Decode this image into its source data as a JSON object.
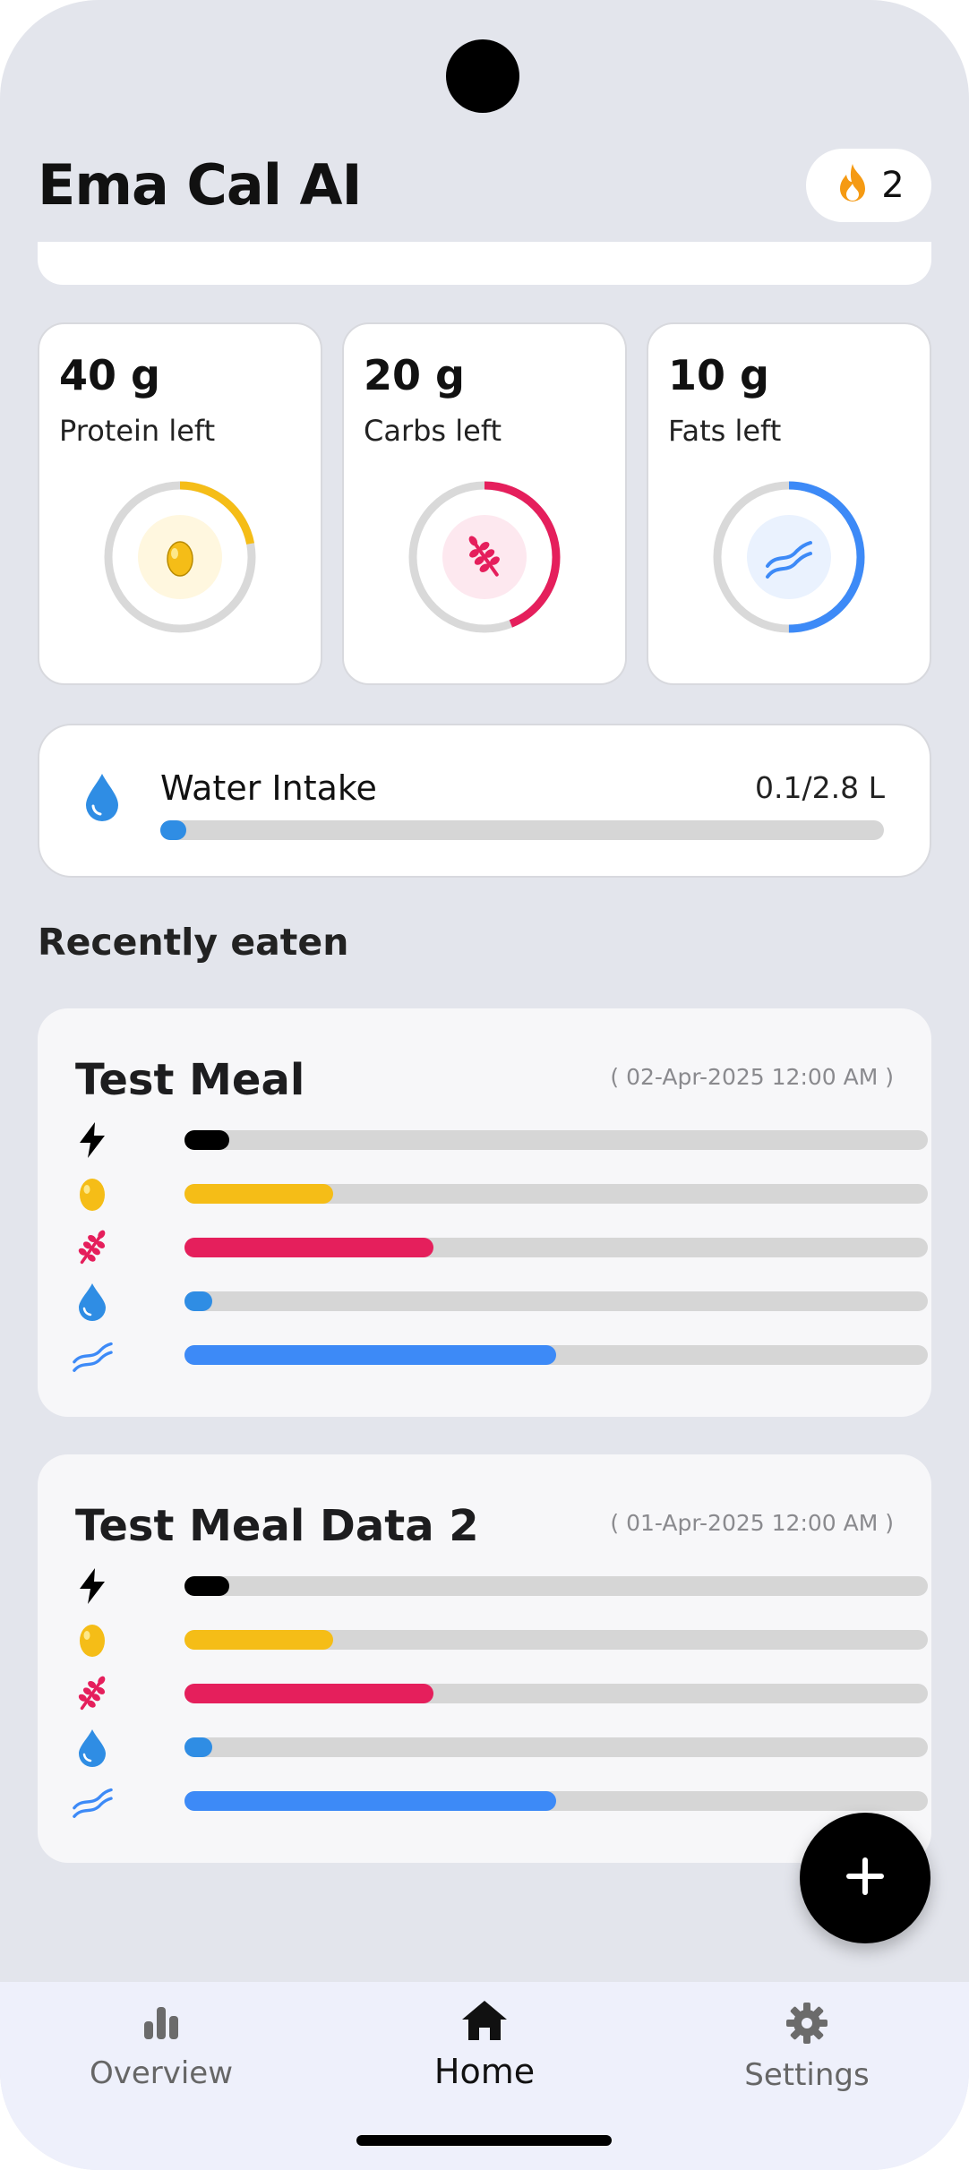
{
  "app": {
    "title": "Ema Cal AI",
    "streak_count": "2"
  },
  "macros": [
    {
      "id": "protein",
      "value": "40 g",
      "label": "Protein left",
      "progress": 0.22,
      "color": "#f5bd17",
      "bg": "#fff7df",
      "icon": "egg-icon"
    },
    {
      "id": "carbs",
      "value": "20 g",
      "label": "Carbs left",
      "progress": 0.44,
      "color": "#e51f5c",
      "bg": "#fde8ef",
      "icon": "wheat-icon"
    },
    {
      "id": "fats",
      "value": "10 g",
      "label": "Fats left",
      "progress": 0.5,
      "color": "#3d8af7",
      "bg": "#eaf2fe",
      "icon": "bacon-icon"
    }
  ],
  "water": {
    "title": "Water Intake",
    "value": "0.1/2.8 L",
    "progress": 0.036
  },
  "recent": {
    "title": "Recently eaten",
    "meals": [
      {
        "name": "Test Meal",
        "date": "( 02-Apr-2025 12:00 AM )",
        "bars": [
          {
            "icon": "lightning-icon",
            "color": "#000000",
            "progress": 0.06
          },
          {
            "icon": "egg-icon",
            "color": "#f5bd17",
            "progress": 0.2
          },
          {
            "icon": "wheat-icon",
            "color": "#e51f5c",
            "progress": 0.335
          },
          {
            "icon": "water-drop-icon",
            "color": "#2f8de4",
            "progress": 0.037
          },
          {
            "icon": "bacon-icon",
            "color": "#3d8af7",
            "progress": 0.5
          }
        ]
      },
      {
        "name": "Test Meal Data 2",
        "date": "( 01-Apr-2025 12:00 AM )",
        "bars": [
          {
            "icon": "lightning-icon",
            "color": "#000000",
            "progress": 0.06
          },
          {
            "icon": "egg-icon",
            "color": "#f5bd17",
            "progress": 0.2
          },
          {
            "icon": "wheat-icon",
            "color": "#e51f5c",
            "progress": 0.335
          },
          {
            "icon": "water-drop-icon",
            "color": "#2f8de4",
            "progress": 0.037
          },
          {
            "icon": "bacon-icon",
            "color": "#3d8af7",
            "progress": 0.5
          }
        ]
      }
    ]
  },
  "nav": {
    "items": [
      {
        "label": "Overview",
        "icon": "bar-chart-icon",
        "active": false
      },
      {
        "label": "Home",
        "icon": "home-icon",
        "active": true
      },
      {
        "label": "Settings",
        "icon": "gear-icon",
        "active": false
      }
    ]
  }
}
